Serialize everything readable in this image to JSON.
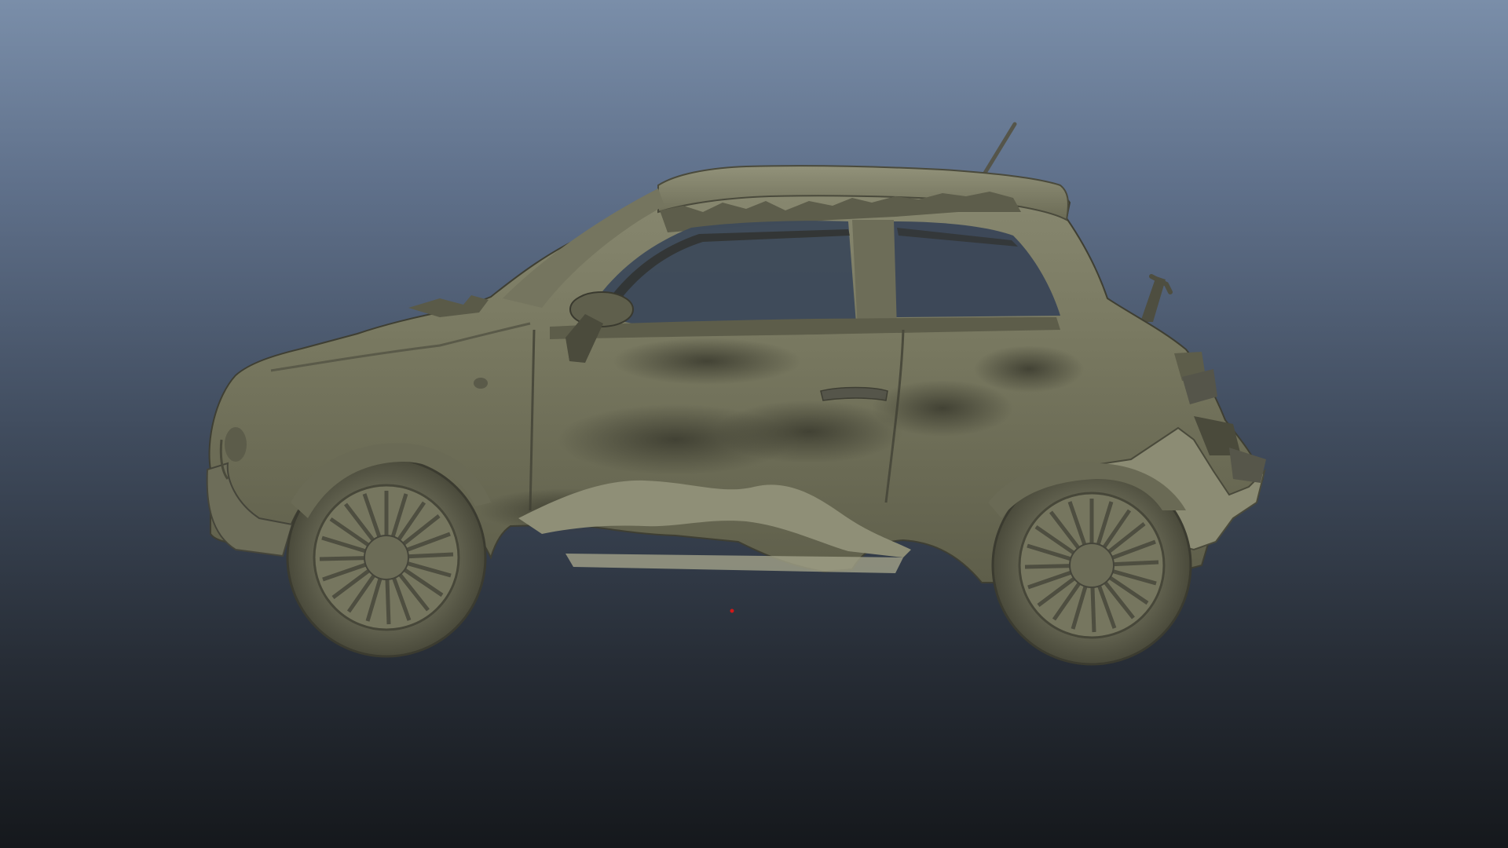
{
  "viewport": {
    "background_top": "#7a8ea9",
    "background_bottom": "#15181c",
    "model_color": "#7b7b66",
    "model_shadow_color": "#3b3b30",
    "model_highlight_color": "#9b9b82",
    "origin_marker_color": "#d01818"
  },
  "model": {
    "icon": "damaged-car-model-icon"
  }
}
